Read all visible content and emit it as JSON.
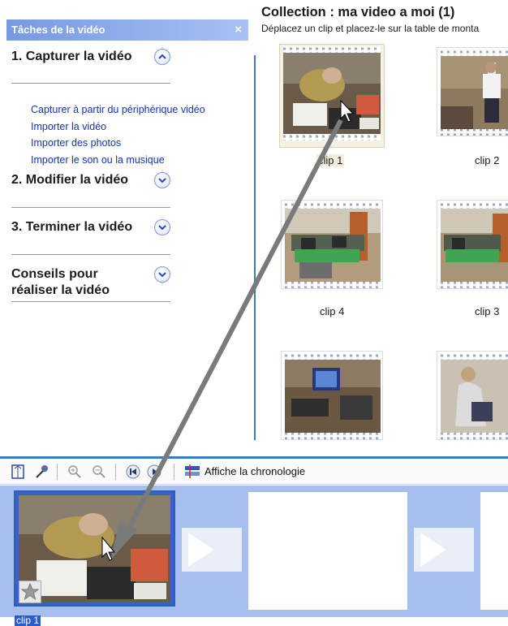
{
  "task_pane": {
    "title": "Tâches de la vidéo",
    "close_label": "×",
    "sections": [
      {
        "title": "1. Capturer la vidéo",
        "icon": "chevron-up-icon",
        "state": "expanded"
      },
      {
        "title": "2. Modifier la vidéo",
        "icon": "chevron-down-icon",
        "state": "collapsed"
      },
      {
        "title": "3. Terminer la vidéo",
        "icon": "chevron-down-icon",
        "state": "collapsed"
      },
      {
        "title": "Conseils pour réaliser la vidéo",
        "icon": "chevron-down-icon",
        "state": "collapsed"
      }
    ],
    "capture_links": [
      "Capturer à partir du périphérique vidéo",
      "Importer la vidéo",
      "Importer des photos",
      "Importer le son ou la musique"
    ]
  },
  "collection": {
    "title": "Collection : ma  video a moi (1)",
    "subtitle": "Déplacez un clip et placez-le sur la table de monta",
    "clips": [
      {
        "label": "clip 1",
        "selected": true
      },
      {
        "label": "clip 2",
        "selected": false
      },
      {
        "label": "clip 4",
        "selected": false
      },
      {
        "label": "clip 3",
        "selected": false
      },
      {
        "label": "",
        "selected": false
      },
      {
        "label": "",
        "selected": false
      }
    ]
  },
  "toolbar": {
    "icons": [
      "storyboard-icon",
      "narrate-icon",
      "zoom-in-icon",
      "zoom-out-icon",
      "rewind-icon",
      "play-icon",
      "timeline-icon"
    ],
    "show_timeline_label": "Affiche la chronologie"
  },
  "storyboard": {
    "clip_label": "clip 1",
    "effect_icon": "star-icon"
  },
  "colors": {
    "header_gradient_start": "#7799e3",
    "link_color": "#1433b8",
    "storyboard_bg": "#a7bfed",
    "accent": "#3d78cc"
  }
}
